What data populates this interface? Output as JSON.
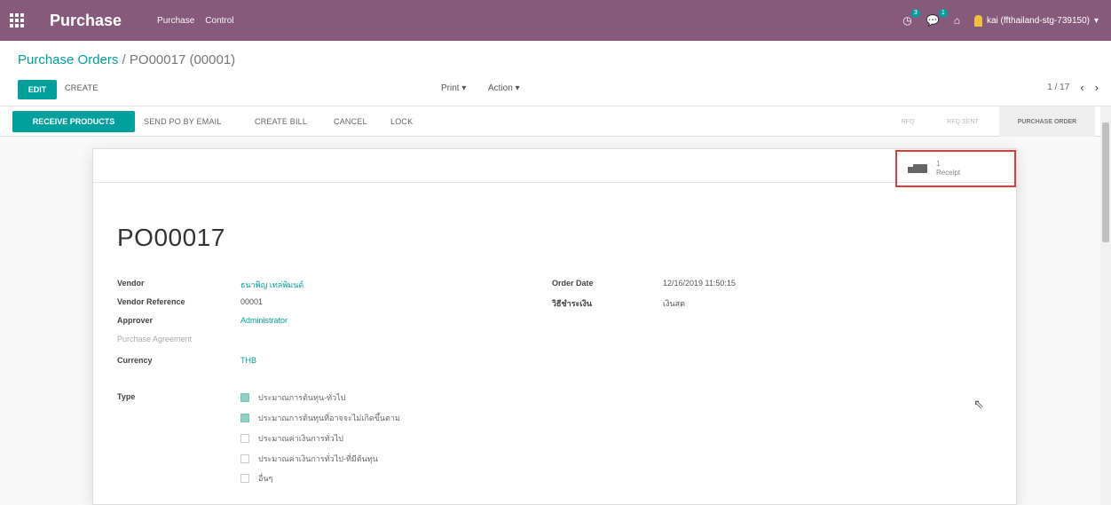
{
  "navbar": {
    "brand": "Purchase",
    "menus": [
      "Purchase",
      "Control"
    ],
    "activity_badge": "3",
    "messages_badge": "1",
    "user": "kai (ffthailand-stg-739150)"
  },
  "breadcrumb": {
    "parent": "Purchase Orders",
    "separator": " / ",
    "current": "PO00017 (00001)"
  },
  "toolbar": {
    "edit": "EDIT",
    "create": "CREATE",
    "print": "Print",
    "action": "Action",
    "pager": "1 / 17"
  },
  "statusbar": {
    "receive": "RECEIVE PRODUCTS",
    "send": "SEND PO BY EMAIL",
    "bill": "CREATE BILL",
    "cancel": "CANCEL",
    "lock": "LOCK",
    "stages": [
      "RFQ",
      "RFQ SENT",
      "PURCHASE ORDER"
    ]
  },
  "receipt": {
    "count": "1",
    "label": "Receipt"
  },
  "form": {
    "title": "PO00017",
    "left": [
      {
        "label": "Vendor",
        "value": "ธนาพิญ เทล่พิมนด์",
        "link": true
      },
      {
        "label": "Vendor Reference",
        "value": "00001",
        "link": false
      },
      {
        "label": "Approver",
        "value": "Administrator",
        "link": true
      },
      {
        "label": "Purchase Agreement",
        "value": "",
        "link": false
      },
      {
        "label": "Currency",
        "value": "THB",
        "link": true
      }
    ],
    "right": [
      {
        "label": "Order Date",
        "value": "12/16/2019 11:50:15"
      },
      {
        "label": "วิธีชำระเงิน",
        "value": "เงินสด"
      }
    ],
    "type_label": "Type",
    "types": [
      {
        "label": "ประมาณการต้นทุน-ทั่วไป",
        "checked": true
      },
      {
        "label": "ประมาณการต้นทุนที่อาจจะไม่เกิดขึ้นตาม",
        "checked": true
      },
      {
        "label": "ประมาณค่าเงินการทั่วไป",
        "checked": false
      },
      {
        "label": "ประมาณค่าเงินการทั่วไป-ที่มีต้นทุน",
        "checked": false
      },
      {
        "label": "อื่นๆ",
        "checked": false
      }
    ]
  }
}
